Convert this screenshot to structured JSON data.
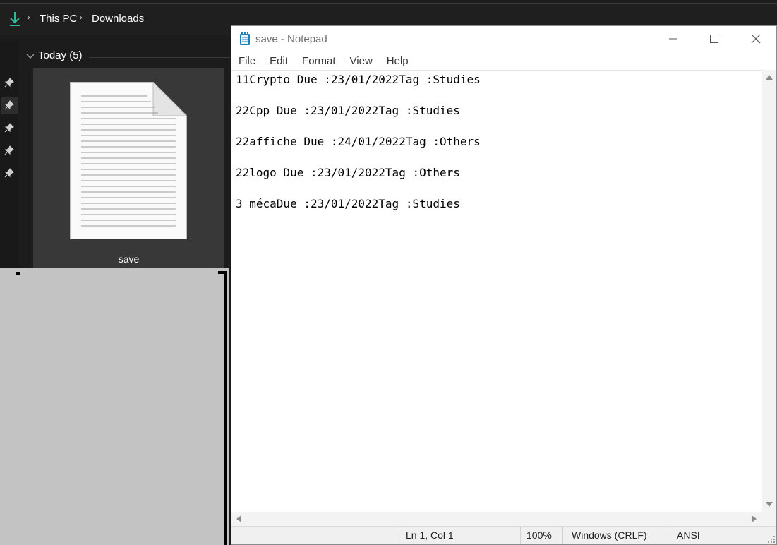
{
  "explorer": {
    "breadcrumb": [
      "This PC",
      "Downloads"
    ],
    "group_header": "Today (5)",
    "file": {
      "name": "save"
    }
  },
  "notepad": {
    "title": "save - Notepad",
    "menu": [
      "File",
      "Edit",
      "Format",
      "View",
      "Help"
    ],
    "content": "11Crypto Due :23/01/2022Tag :Studies\n\n22Cpp Due :23/01/2022Tag :Studies\n\n22affiche Due :24/01/2022Tag :Others\n\n22logo Due :23/01/2022Tag :Others\n\n3 mécaDue :23/01/2022Tag :Studies",
    "status": {
      "position": "Ln 1, Col 1",
      "zoom": "100%",
      "line_ending": "Windows (CRLF)",
      "encoding": "ANSI"
    }
  },
  "colors": {
    "accent_download": "#2fb9a0",
    "notepad_icon": "#1e7fb8"
  }
}
